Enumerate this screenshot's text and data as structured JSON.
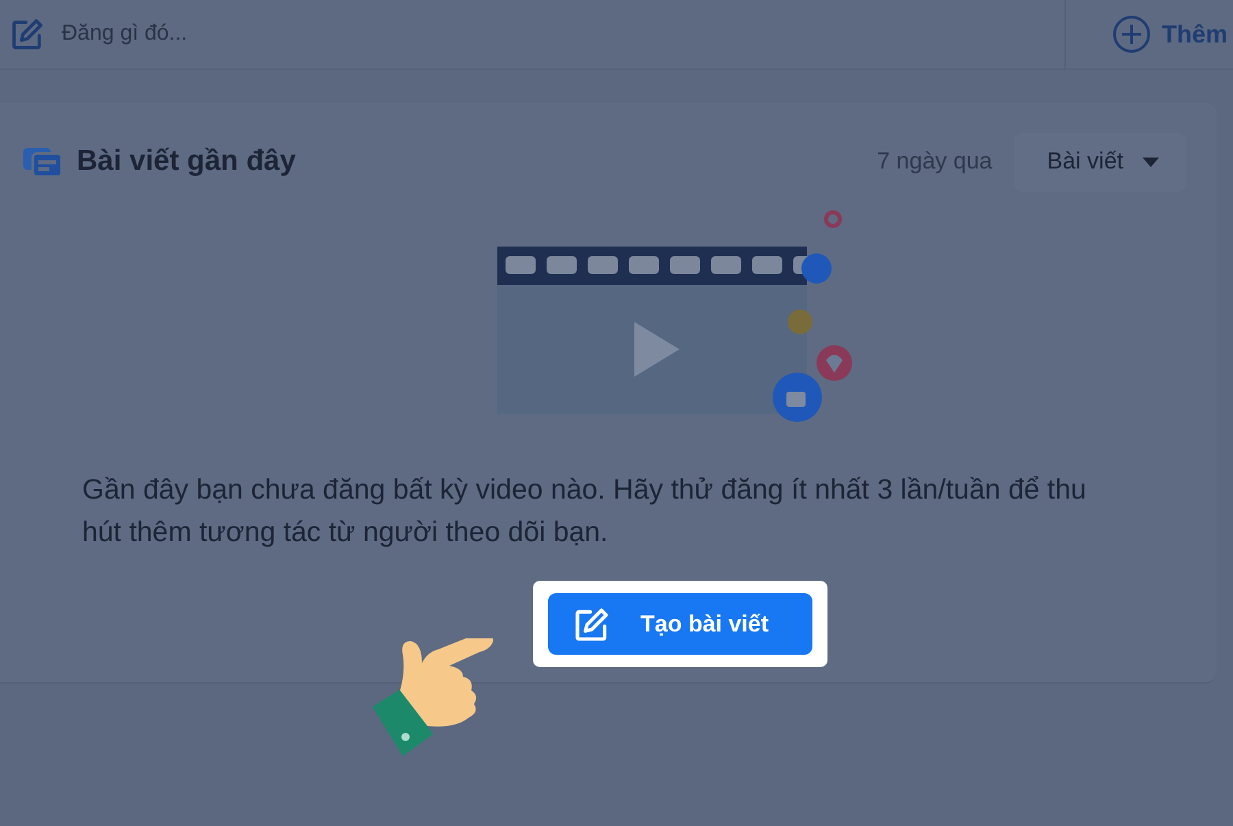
{
  "composer": {
    "placeholder": "Đăng gì đó...",
    "add_label": "Thêm"
  },
  "recent_posts": {
    "title": "Bài viết gần đây",
    "period": "7 ngày qua",
    "filter": "Bài viết",
    "message": "Gần đây bạn chưa đăng bất kỳ video nào. Hãy thử đăng ít nhất 3 lần/tuần để thu hút thêm tương tác từ người theo dõi bạn.",
    "create_button": "Tạo bài viết"
  }
}
